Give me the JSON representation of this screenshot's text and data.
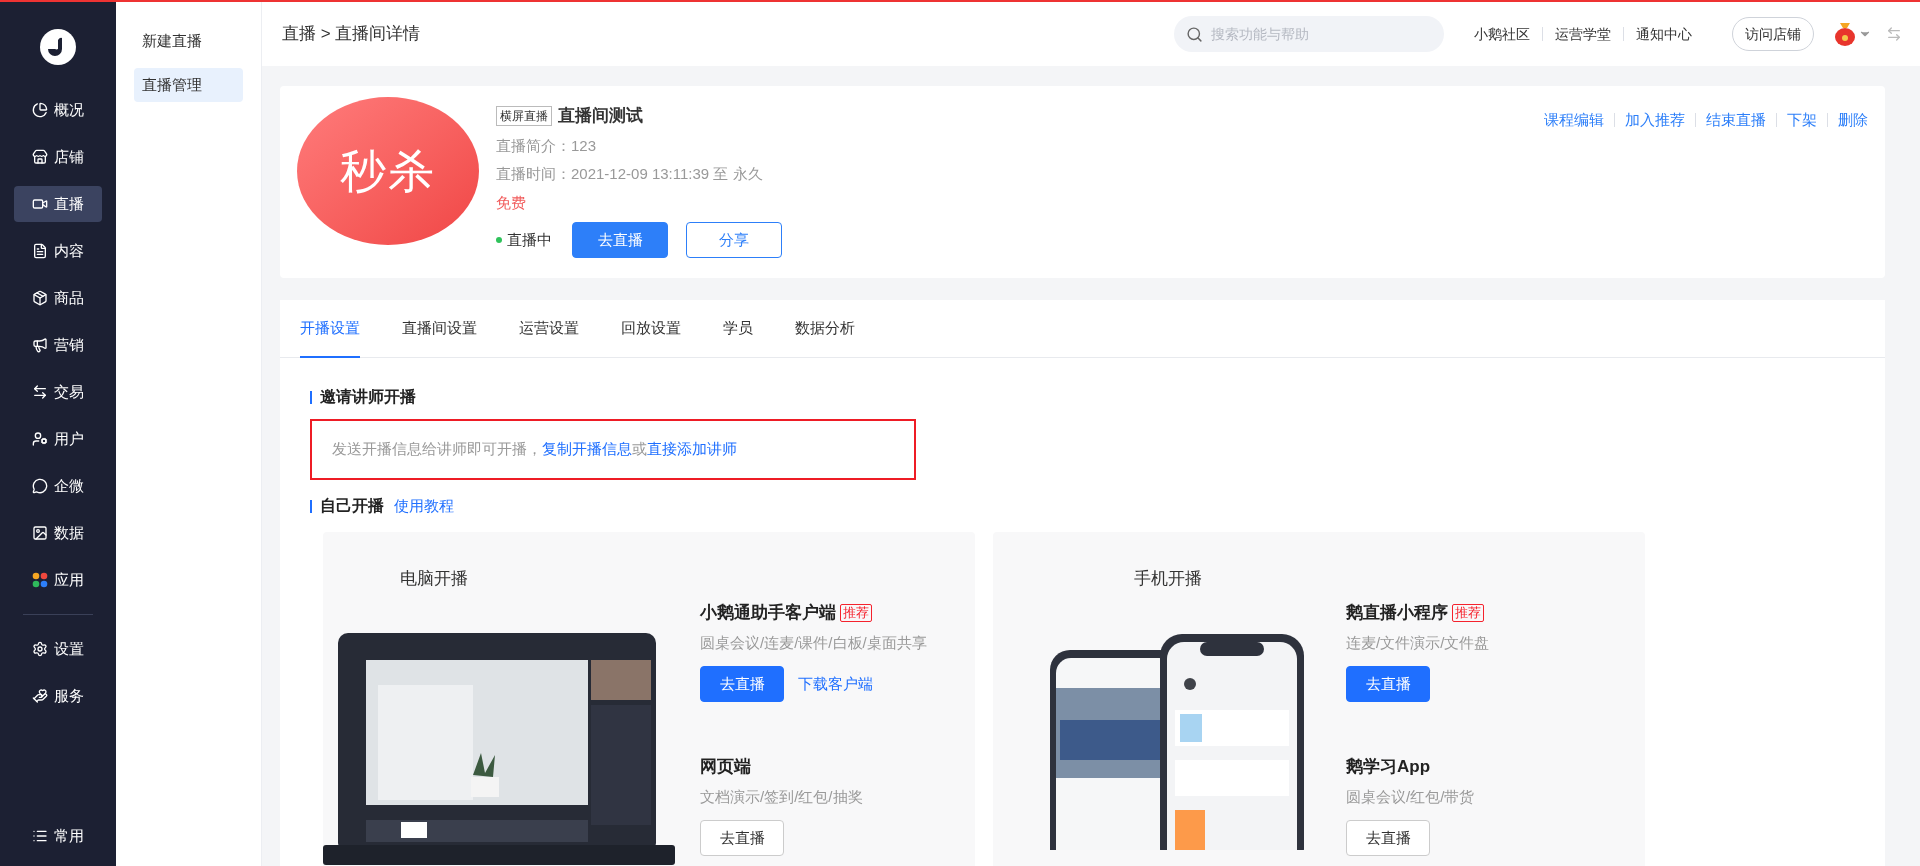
{
  "sidebar": {
    "items": [
      {
        "label": "概况",
        "selected": false
      },
      {
        "label": "店铺",
        "selected": false
      },
      {
        "label": "直播",
        "selected": true
      },
      {
        "label": "内容",
        "selected": false
      },
      {
        "label": "商品",
        "selected": false
      },
      {
        "label": "营销",
        "selected": false
      },
      {
        "label": "交易",
        "selected": false
      },
      {
        "label": "用户",
        "selected": false
      },
      {
        "label": "企微",
        "selected": false
      },
      {
        "label": "数据",
        "selected": false
      },
      {
        "label": "应用",
        "selected": false
      }
    ],
    "lower_items": [
      {
        "label": "设置",
        "selected": false
      },
      {
        "label": "服务",
        "selected": false
      }
    ],
    "footer_item": {
      "label": "常用"
    }
  },
  "subnav": {
    "items": [
      {
        "label": "新建直播",
        "selected": false
      },
      {
        "label": "直播管理",
        "selected": true
      }
    ]
  },
  "header": {
    "breadcrumb": "直播 > 直播间详情",
    "search": {
      "placeholder": "搜索功能与帮助"
    },
    "links": [
      "小鹅社区",
      "运营学堂",
      "通知中心"
    ],
    "visit_button": "访问店铺"
  },
  "course": {
    "cover_text": "秒杀",
    "tag": "横屏直播",
    "title": "直播间测试",
    "intro": "直播简介：123",
    "time": "直播时间：2021-12-09 13:11:39 至 永久",
    "price": "免费",
    "status": {
      "label": "直播中",
      "live": true
    },
    "buttons": [
      {
        "label": "去直播",
        "primary": true
      },
      {
        "label": "分享",
        "primary": false
      }
    ],
    "actions": [
      "课程编辑",
      "加入推荐",
      "结束直播",
      "下架",
      "删除"
    ]
  },
  "tabs": [
    {
      "label": "开播设置",
      "selected": true
    },
    {
      "label": "直播间设置",
      "selected": false
    },
    {
      "label": "运营设置",
      "selected": false
    },
    {
      "label": "回放设置",
      "selected": false
    },
    {
      "label": "学员",
      "selected": false
    },
    {
      "label": "数据分析",
      "selected": false
    }
  ],
  "invite": {
    "heading": "邀请讲师开播",
    "text": "发送开播信息给讲师即可开播，",
    "link_1": "复制开播信息",
    "joiner": "或",
    "link_2": "直接添加讲师"
  },
  "self_live": {
    "heading": "自己开播",
    "link": "使用教程"
  },
  "platforms": [
    {
      "title": "电脑开播",
      "kind": "laptop",
      "options": [
        {
          "name": "小鹅通助手客户端",
          "badge": "推荐",
          "features": "圆桌会议/连麦/课件/白板/桌面共享",
          "button": "去直播",
          "primary": true,
          "link": "下载客户端"
        },
        {
          "name": "网页端",
          "features": "文档演示/签到/红包/抽奖",
          "button": "去直播",
          "primary": false
        }
      ]
    },
    {
      "title": "手机开播",
      "kind": "phone",
      "options": [
        {
          "name": "鹅直播小程序",
          "badge": "推荐",
          "features": "连麦/文件演示/文件盘",
          "button": "去直播",
          "primary": true
        },
        {
          "name": "鹅学习App",
          "features": "圆桌会议/红包/带货",
          "button": "去直播",
          "primary": false
        }
      ]
    }
  ]
}
